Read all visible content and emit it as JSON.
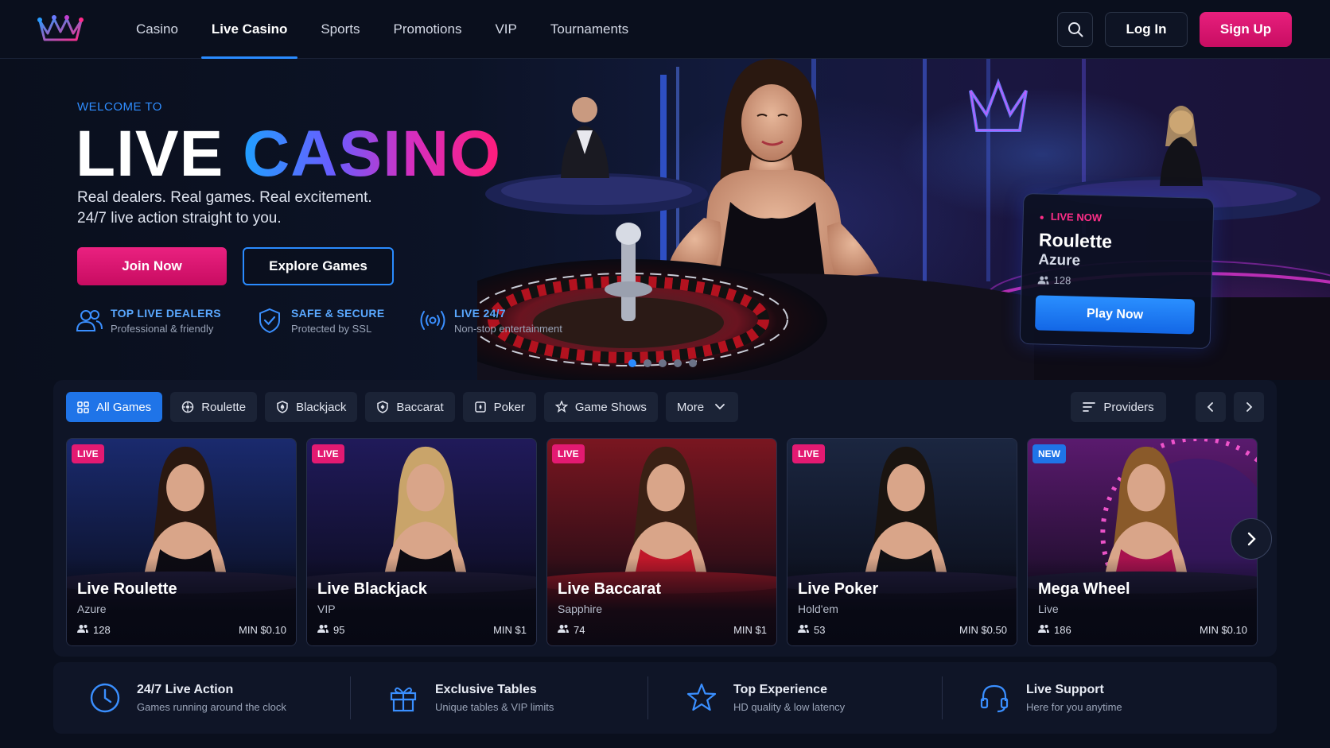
{
  "nav": {
    "links": [
      "Casino",
      "Live Casino",
      "Sports",
      "Promotions",
      "VIP",
      "Tournaments"
    ],
    "active": "Live Casino",
    "login_label": "Log In",
    "signup_label": "Sign Up"
  },
  "hero": {
    "welcome": "WELCOME TO",
    "title_1": "LIVE",
    "title_2": "CASINO",
    "subtitle_1": "Real dealers. Real games. Real excitement.",
    "subtitle_2": "24/7 live action straight to you.",
    "join_label": "Join Now",
    "explore_label": "Explore Games",
    "features": [
      {
        "title": "TOP LIVE DEALERS",
        "subtitle": "Professional & friendly",
        "icon": "users-icon"
      },
      {
        "title": "SAFE & SECURE",
        "subtitle": "Protected by SSL",
        "icon": "shield-check-icon"
      },
      {
        "title": "LIVE 24/7",
        "subtitle": "Non-stop entertainment",
        "icon": "broadcast-icon"
      }
    ],
    "carousel": {
      "slides": 5,
      "active_index": 0
    },
    "live_card": {
      "status": "LIVE NOW",
      "title": "Roulette",
      "subtitle": "Azure",
      "players": "128",
      "play_label": "Play Now"
    }
  },
  "filters": {
    "chips": [
      "All Games",
      "Roulette",
      "Blackjack",
      "Baccarat",
      "Poker",
      "Game Shows",
      "More"
    ],
    "active": "All Games",
    "providers_label": "Providers"
  },
  "games": [
    {
      "badge": "LIVE",
      "name": "Live Roulette",
      "subtitle": "Azure",
      "players": "128",
      "min": "MIN $0.10",
      "theme": "#1a2a6e"
    },
    {
      "badge": "LIVE",
      "name": "Live Blackjack",
      "subtitle": "VIP",
      "players": "95",
      "min": "MIN $1",
      "theme": "#201a5a"
    },
    {
      "badge": "LIVE",
      "name": "Live Baccarat",
      "subtitle": "Sapphire",
      "players": "74",
      "min": "MIN $1",
      "theme": "#7a1620"
    },
    {
      "badge": "LIVE",
      "name": "Live Poker",
      "subtitle": "Hold'em",
      "players": "53",
      "min": "MIN $0.50",
      "theme": "#1b2640"
    },
    {
      "badge": "NEW",
      "name": "Mega Wheel",
      "subtitle": "Live",
      "players": "186",
      "min": "MIN $0.10",
      "theme": "#5a1a6e"
    }
  ],
  "benefits": [
    {
      "title": "24/7 Live Action",
      "subtitle": "Games running around the clock",
      "icon": "clock-icon"
    },
    {
      "title": "Exclusive Tables",
      "subtitle": "Unique tables & VIP limits",
      "icon": "gift-icon"
    },
    {
      "title": "Top Experience",
      "subtitle": "HD quality & low latency",
      "icon": "star-icon"
    },
    {
      "title": "Live Support",
      "subtitle": "Here for you anytime",
      "icon": "headset-icon"
    }
  ],
  "colors": {
    "accent_blue": "#1f74e8",
    "accent_pink": "#e31a72",
    "background": "#0a0f1d",
    "panel": "#0f1527"
  }
}
